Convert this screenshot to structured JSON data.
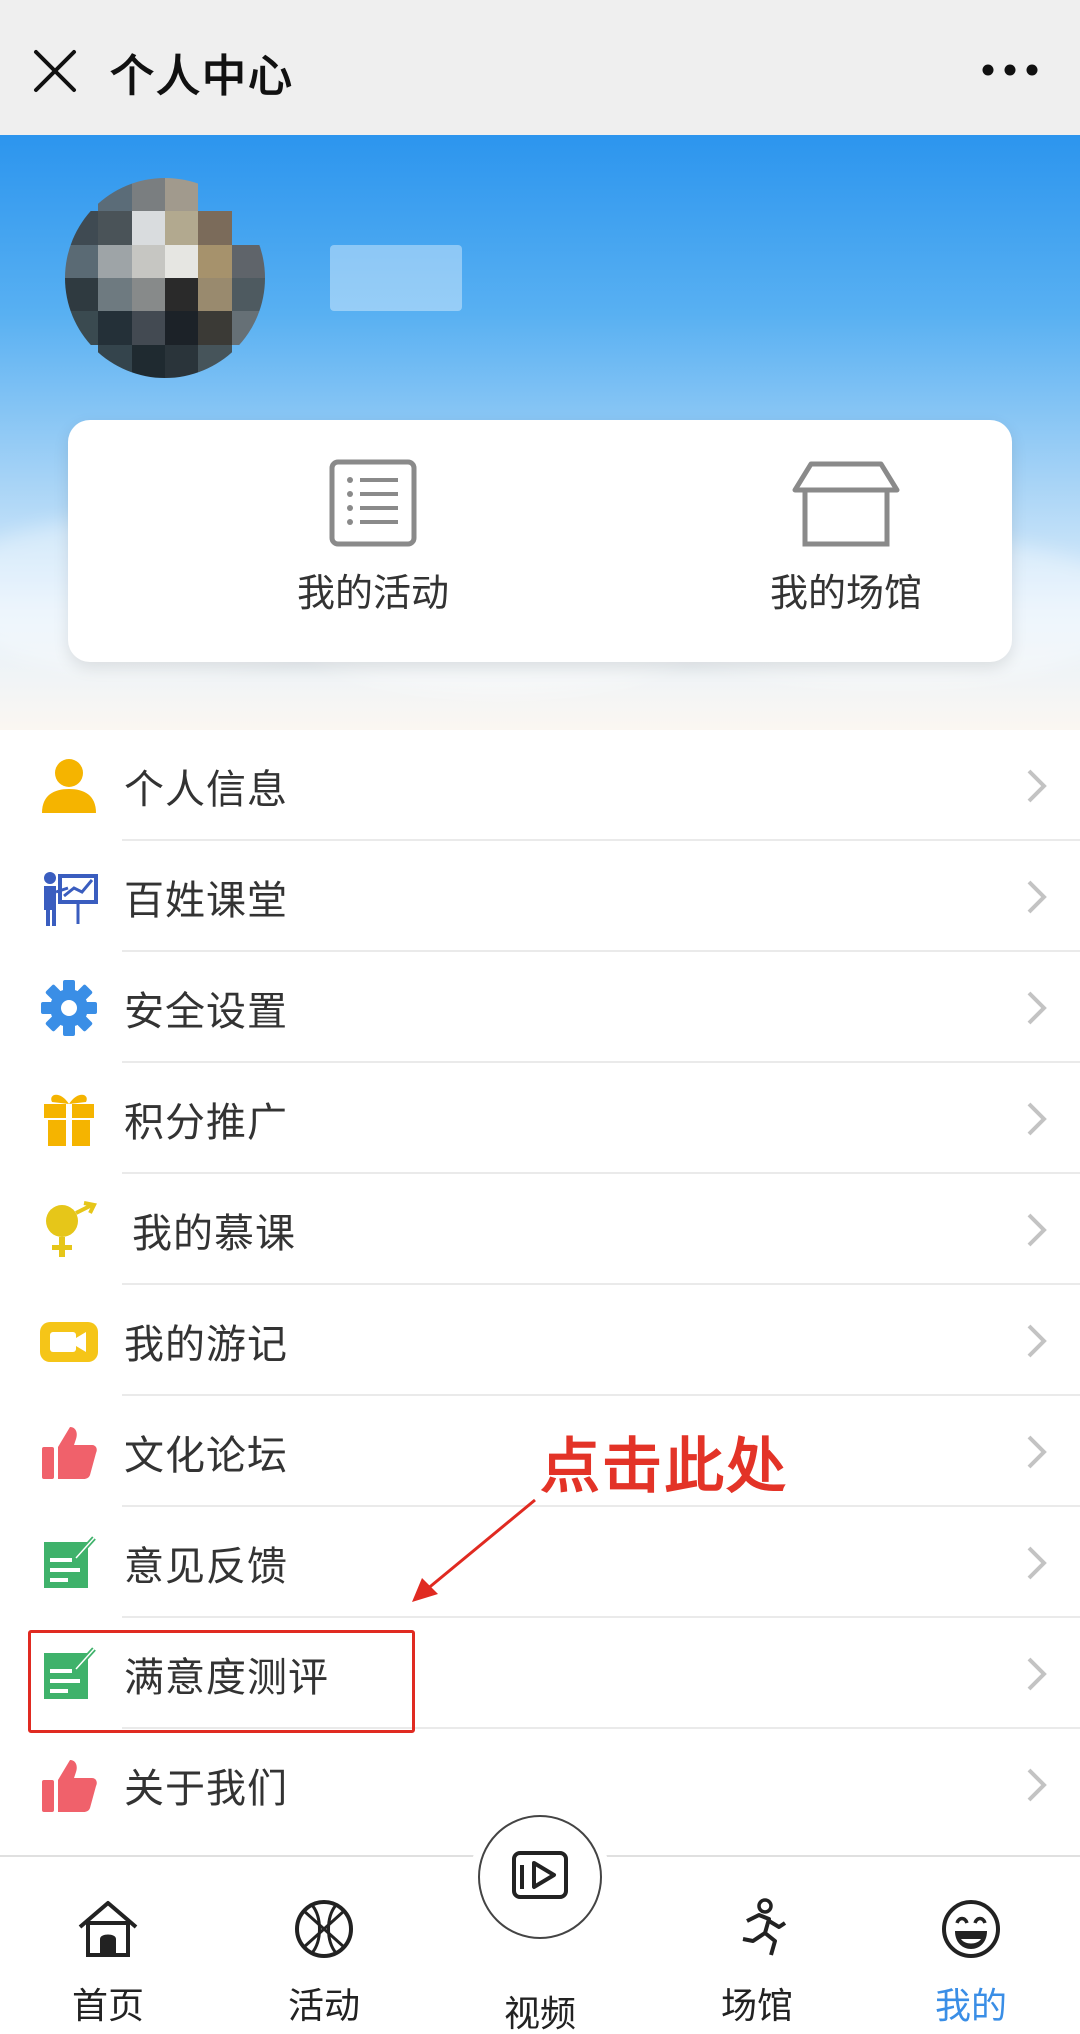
{
  "titlebar": {
    "title": "个人中心",
    "close_icon": "close-icon",
    "more_icon": "more-dots-icon"
  },
  "quick_actions": [
    {
      "label": "我的活动",
      "icon": "list-document-icon"
    },
    {
      "label": "我的场馆",
      "icon": "box-icon"
    }
  ],
  "menu": [
    {
      "label": "个人信息",
      "icon": "user-icon",
      "color": "#f5b400"
    },
    {
      "label": "百姓课堂",
      "icon": "teacher-board-icon",
      "color": "#3a5dbf"
    },
    {
      "label": "安全设置",
      "icon": "gear-icon",
      "color": "#3a8ee6"
    },
    {
      "label": "积分推广",
      "icon": "gift-icon",
      "color": "#f5b400"
    },
    {
      "label": "我的慕课",
      "icon": "gender-symbol-icon",
      "color": "#e6c619"
    },
    {
      "label": "我的游记",
      "icon": "video-camera-icon",
      "color": "#f5c518"
    },
    {
      "label": "文化论坛",
      "icon": "thumbs-up-icon",
      "color": "#f0616b"
    },
    {
      "label": "意见反馈",
      "icon": "edit-note-icon",
      "color": "#3fb26b"
    },
    {
      "label": "满意度测评",
      "icon": "edit-note-icon",
      "color": "#3fb26b"
    },
    {
      "label": "关于我们",
      "icon": "thumbs-up-icon",
      "color": "#f0616b"
    }
  ],
  "annotation": {
    "text": "点击此处",
    "color": "#e33327"
  },
  "bottom_nav": [
    {
      "label": "首页",
      "icon": "home-icon",
      "active": false
    },
    {
      "label": "活动",
      "icon": "basketball-icon",
      "active": false
    },
    {
      "label": "视频",
      "icon": "play-video-icon",
      "active": false
    },
    {
      "label": "场馆",
      "icon": "running-icon",
      "active": false
    },
    {
      "label": "我的",
      "icon": "smile-icon",
      "active": true
    }
  ],
  "colors": {
    "accent": "#3a8ee6",
    "header_top": "#2c95ee",
    "highlight": "#e02a21"
  }
}
